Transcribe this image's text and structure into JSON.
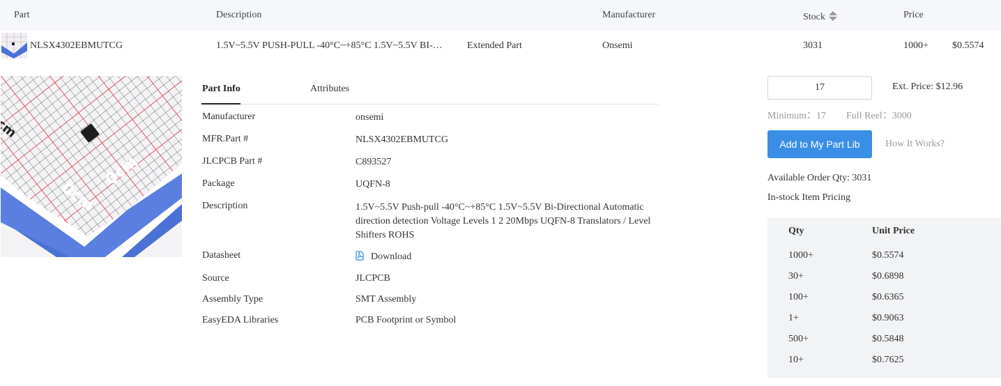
{
  "header": {
    "part": "Part",
    "description": "Description",
    "manufacturer": "Manufacturer",
    "stock": "Stock",
    "price": "Price"
  },
  "row": {
    "part_number": "NLSX4302EBMUTCG",
    "description": "1.5V~5.5V PUSH-PULL -40°C~+85°C 1.5V~5.5V BI-…",
    "type": "Extended Part",
    "manufacturer": "Onsemi",
    "stock": "3031",
    "price_qty": "1000+",
    "price": "$0.5574"
  },
  "image": {
    "mark_0cm_a": "0cm",
    "mark_0cm_b": "0cm",
    "mark_cm": "cm"
  },
  "tabs": {
    "part_info": "Part Info",
    "attributes": "Attributes"
  },
  "info": {
    "manufacturer_label": "Manufacturer",
    "manufacturer": "onsemi",
    "mfr_part_label": "MFR.Part #",
    "mfr_part": "NLSX4302EBMUTCG",
    "jlcpcb_part_label": "JLCPCB Part #",
    "jlcpcb_part": "C893527",
    "package_label": "Package",
    "package": "UQFN-8",
    "description_label": "Description",
    "description": "1.5V~5.5V Push-pull -40°C~+85°C 1.5V~5.5V Bi-Directional Automatic direction detection Voltage Levels 1 2 20Mbps UQFN-8 Translators / Level Shifters ROHS",
    "datasheet_label": "Datasheet",
    "datasheet_link": "Download",
    "source_label": "Source",
    "source": "JLCPCB",
    "assembly_label": "Assembly Type",
    "assembly": "SMT Assembly",
    "easyeda_label": "EasyEDA Libraries",
    "easyeda_link": "PCB Footprint or Symbol"
  },
  "order": {
    "quantity": "17",
    "ext_price": "Ext. Price: $12.96",
    "minimum": "Minimum：17",
    "full_reel": "Full Reel：3000",
    "add_button": "Add to My Part Lib",
    "how_it_works": "How It Works?",
    "available": "Available Order Qty: 3031",
    "instock_pricing": "In-stock Item Pricing"
  },
  "pricing": {
    "qty_header": "Qty",
    "unit_header": "Unit Price",
    "rows": [
      {
        "qty": "1000+",
        "price": "$0.5574"
      },
      {
        "qty": "30+",
        "price": "$0.6898"
      },
      {
        "qty": "100+",
        "price": "$0.6365"
      },
      {
        "qty": "1+",
        "price": "$0.9063"
      },
      {
        "qty": "500+",
        "price": "$0.5848"
      },
      {
        "qty": "10+",
        "price": "$0.7625"
      }
    ]
  },
  "colors": {
    "accent": "#3a8ee6",
    "header_bg": "#f5f7fa",
    "table_bg": "#f2f3f5"
  }
}
